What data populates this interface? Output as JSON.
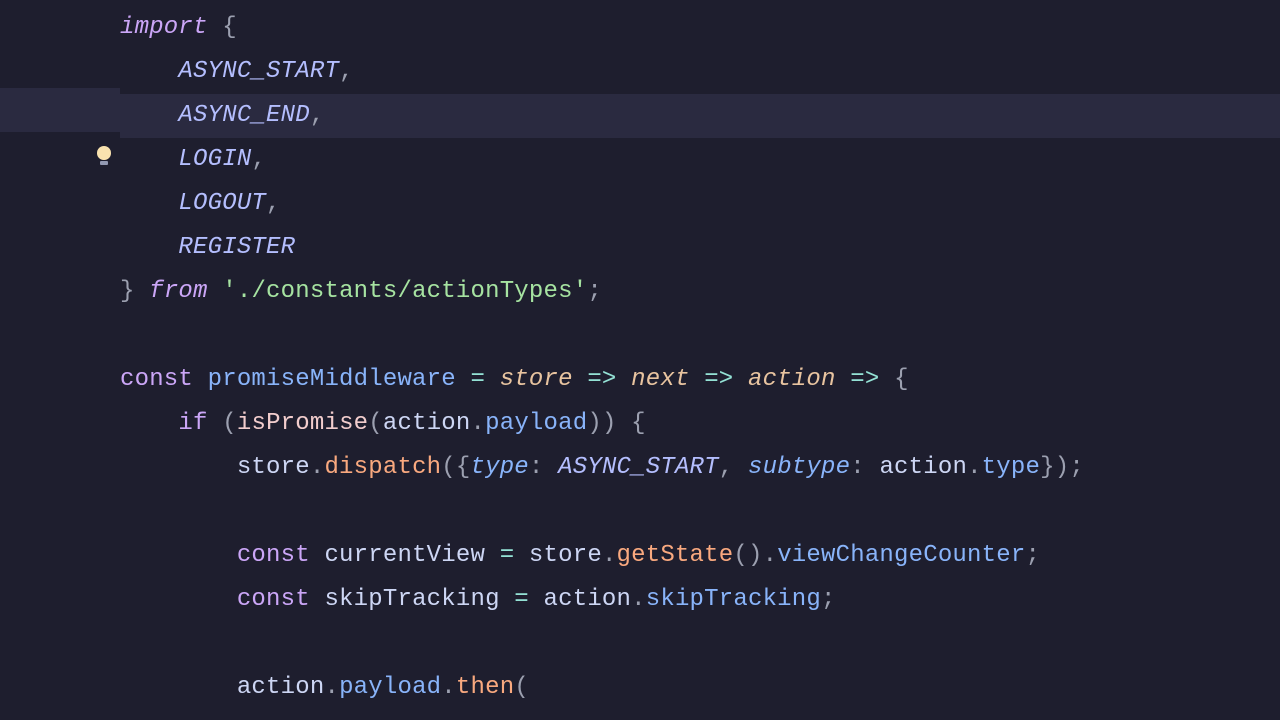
{
  "gutter": {
    "bulb_icon": "lightbulb-icon"
  },
  "code": {
    "l1": {
      "import": "import",
      "brace": "{"
    },
    "l2": {
      "const": "ASYNC_START",
      "comma": ","
    },
    "l3": {
      "const": "ASYNC_END",
      "comma": ","
    },
    "l4": {
      "const": "LOGIN",
      "comma": ","
    },
    "l5": {
      "const": "LOGOUT",
      "comma": ","
    },
    "l6": {
      "const": "REGISTER"
    },
    "l7": {
      "brace": "}",
      "from": "from",
      "str": "'./constants/actionTypes'",
      "semi": ";"
    },
    "l9": {
      "const": "const",
      "name": "promiseMiddleware",
      "eq": "=",
      "p1": "store",
      "ar1": "=>",
      "p2": "next",
      "ar2": "=>",
      "p3": "action",
      "ar3": "=>",
      "brace": "{"
    },
    "l10": {
      "if": "if",
      "lp": "(",
      "fn": "isPromise",
      "lp2": "(",
      "obj": "action",
      "dot": ".",
      "prop": "payload",
      "rp2": ")",
      "rp": ")",
      "brace": "{"
    },
    "l11": {
      "obj": "store",
      "dot": ".",
      "m": "dispatch",
      "lp": "(",
      "lb": "{",
      "k1": "type",
      "c1": ":",
      "v1": "ASYNC_START",
      "comma": ",",
      "k2": "subtype",
      "c2": ":",
      "v2a": "action",
      "v2d": ".",
      "v2p": "type",
      "rb": "}",
      "rp": ")",
      "semi": ";"
    },
    "l13": {
      "const": "const",
      "name": "currentView",
      "eq": "=",
      "obj": "store",
      "dot": ".",
      "m": "getState",
      "lp": "(",
      "rp": ")",
      "dot2": ".",
      "prop": "viewChangeCounter",
      "semi": ";"
    },
    "l14": {
      "const": "const",
      "name": "skipTracking",
      "eq": "=",
      "obj": "action",
      "dot": ".",
      "prop": "skipTracking",
      "semi": ";"
    },
    "l16": {
      "obj": "action",
      "dot": ".",
      "p": "payload",
      "dot2": ".",
      "m": "then",
      "lp": "("
    }
  }
}
